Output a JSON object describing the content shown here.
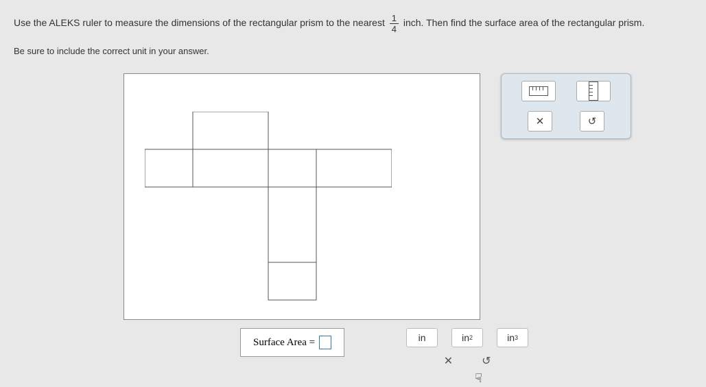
{
  "instruction": {
    "part1": "Use the ALEKS ruler to measure the dimensions of the rectangular prism to the nearest",
    "fraction_num": "1",
    "fraction_den": "4",
    "part2": "inch. Then find the surface area of the rectangular prism."
  },
  "note": "Be sure to include the correct unit in your answer.",
  "toolpanel": {
    "ruler_h_name": "horizontal-ruler",
    "ruler_v_name": "vertical-ruler",
    "clear_label": "✕",
    "reset_label": "↺"
  },
  "answer": {
    "label": "Surface Area =",
    "value": ""
  },
  "units": {
    "u1": "in",
    "u2_base": "in",
    "u2_sup": "2",
    "u3_base": "in",
    "u3_sup": "3",
    "clear": "✕",
    "reset": "↺"
  }
}
